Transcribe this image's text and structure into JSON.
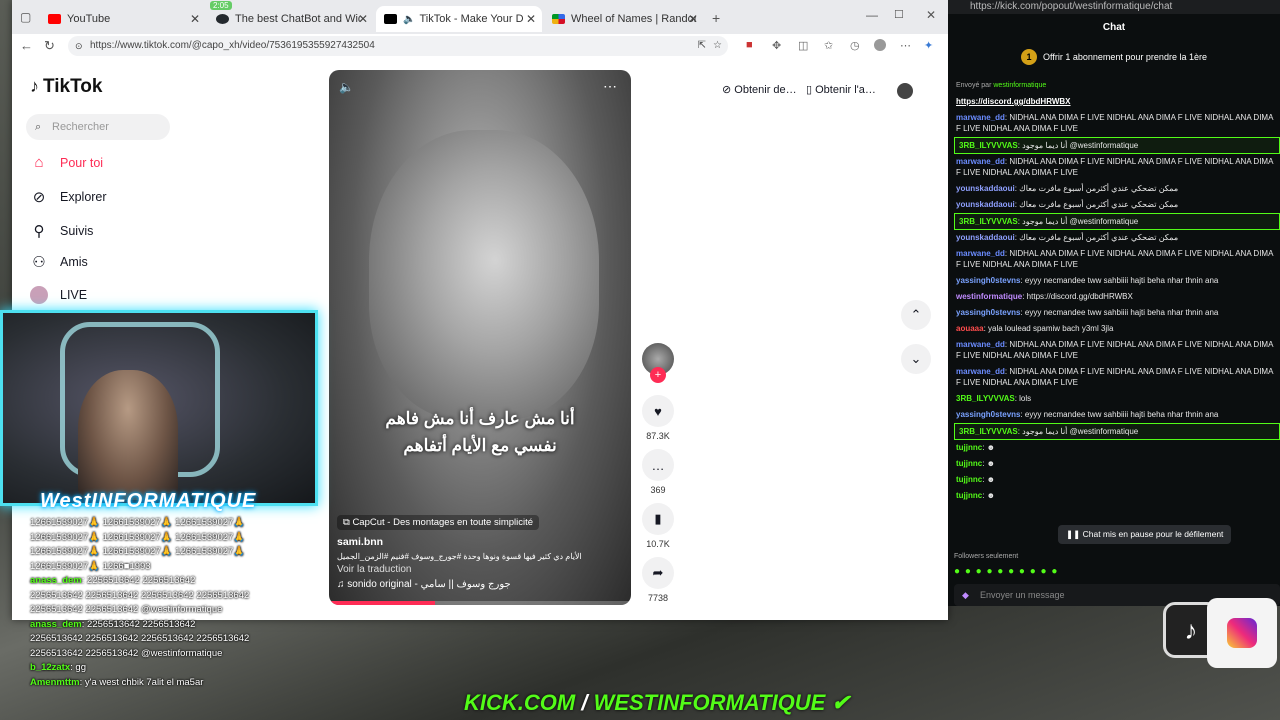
{
  "browser": {
    "tabs": [
      {
        "label": "YouTube",
        "favicon_color": "#ff0000"
      },
      {
        "label": "The best ChatBot and Widgets fo",
        "favicon_color": "#24292e"
      },
      {
        "label": "TikTok - Make Your Day",
        "favicon_color": "#000000",
        "active": true
      },
      {
        "label": "Wheel of Names | Random name",
        "favicon_color": "#3369e8"
      }
    ],
    "tab_badge": "2:05",
    "url": "https://www.tiktok.com/@capo_xh/video/7536195355927432504"
  },
  "tiktok": {
    "logo_text": "TikTok",
    "search_placeholder": "Rechercher",
    "nav": [
      {
        "label": "Pour toi",
        "icon": "home-icon",
        "active": true
      },
      {
        "label": "Explorer",
        "icon": "compass-icon"
      },
      {
        "label": "Suivis",
        "icon": "following-icon"
      },
      {
        "label": "Amis",
        "icon": "friends-icon"
      },
      {
        "label": "LIVE",
        "icon": "live-avatar-icon"
      }
    ],
    "header_buttons": {
      "get_coins": "Obtenir de…",
      "get_app": "Obtenir l'a…"
    },
    "video": {
      "caption_line1": "أنا مش عارف أنا مش فاهم",
      "caption_line2": "نفسي مع الأيام أتفاهم",
      "capcut": "CapCut - Des montages en toute simplicité",
      "author": "sami.bnn",
      "description": "الأيام دي كثير فيها قسوة ونوها وحدة #جورج_وسوف #فنيم #الزمن_الجميل",
      "translate": "Voir la traduction",
      "sound": "sonido original - جورج وسوف || سامي",
      "progress": 0.35
    },
    "actions": {
      "likes": "87.3K",
      "comments": "369",
      "saves": "10.7K",
      "shares": "7738"
    }
  },
  "overlay": {
    "banner": "WestINFORMATIQUE",
    "chat_lines": [
      {
        "user": "",
        "text": "12661539027🙏 12661539027🙏 12661539027🙏"
      },
      {
        "user": "",
        "text": "12661539027🙏 12661539027🙏 12661539027🙏"
      },
      {
        "user": "",
        "text": "12661539027🙏 12661539027🙏 12661539027🙏"
      },
      {
        "user": "",
        "text": "12661539027🙏 1266■1993"
      },
      {
        "user": "anass_dem",
        "text": ": 2256513642 2256513642"
      },
      {
        "user": "",
        "text": "2256513642 2256513642 2256513642 2256513642"
      },
      {
        "user": "",
        "text": "2256513642 2256513642 @westinformatique"
      },
      {
        "user": "anass_dem",
        "text": ": 2256513642 2256513642"
      },
      {
        "user": "",
        "text": "2256513642 2256513642 2256513642 2256513642"
      },
      {
        "user": "",
        "text": "2256513642 2256513642 @westinformatique"
      },
      {
        "user": "b_12zatx",
        "text": ": gg"
      },
      {
        "user": "Amenmttm",
        "text": ": y'a west chbik 7alit el ma5ar"
      }
    ],
    "kick_banner_left": "KICK.COM",
    "kick_banner_right": "WESTINFORMATIQUE"
  },
  "kick": {
    "url": "https://kick.com/popout/westinformatique/chat",
    "title": "Chat",
    "sub_offer": "Offrir 1 abonnement pour prendre la 1ère",
    "sent_by": "Envoyé par",
    "sent_by_user": "westinformatique",
    "pinned_link": "https://discord.gg/dbdHRWBX",
    "messages": [
      {
        "user": "marwane_dd",
        "color": "#6b8cff",
        "text": ": NIDHAL ANA DIMA F LIVE NIDHAL ANA DIMA F LIVE NIDHAL ANA DIMA F LIVE NIDHAL ANA DIMA F LIVE"
      },
      {
        "user": "3RB_ILYVVVAS",
        "color": "#53fc18",
        "text": ": أنا ديما موجود @westinformatique",
        "hl": true
      },
      {
        "user": "marwane_dd",
        "color": "#6b8cff",
        "text": ": NIDHAL ANA DIMA F LIVE NIDHAL ANA DIMA F LIVE NIDHAL ANA DIMA F LIVE NIDHAL ANA DIMA F LIVE"
      },
      {
        "user": "younskaddaoui",
        "color": "#8fa0ff",
        "text": ": ممكن تضحكي عندي أكثرمن أسبوع مافرت معاك"
      },
      {
        "user": "younskaddaoui",
        "color": "#8fa0ff",
        "text": ": ممكن تضحكي عندي أكثرمن أسبوع مافرت معاك"
      },
      {
        "user": "3RB_ILYVVVAS",
        "color": "#53fc18",
        "text": ": أنا ديما موجود @westinformatique",
        "hl": true
      },
      {
        "user": "younskaddaoui",
        "color": "#8fa0ff",
        "text": ": ممكن تضحكي عندي أكثرمن أسبوع مافرت معاك"
      },
      {
        "user": "marwane_dd",
        "color": "#6b8cff",
        "text": ": NIDHAL ANA DIMA F LIVE NIDHAL ANA DIMA F LIVE NIDHAL ANA DIMA F LIVE NIDHAL ANA DIMA F LIVE"
      },
      {
        "user": "yassingh0stevns",
        "color": "#7aa2ff",
        "text": ": eyyy necmandee tww sahbiiii hajti beha nhar thnin ana"
      },
      {
        "user": "westinformatique",
        "color": "#c08bff",
        "text": ": https://discord.gg/dbdHRWBX"
      },
      {
        "user": "yassingh0stevns",
        "color": "#7aa2ff",
        "text": ": eyyy necmandee tww sahbiiii hajti beha nhar thnin ana"
      },
      {
        "user": "aouaaa",
        "color": "#ff4d4d",
        "text": ": yala loulead spamiw bach y3ml 3jla"
      },
      {
        "user": "marwane_dd",
        "color": "#6b8cff",
        "text": ": NIDHAL ANA DIMA F LIVE NIDHAL ANA DIMA F LIVE NIDHAL ANA DIMA F LIVE NIDHAL ANA DIMA F LIVE"
      },
      {
        "user": "marwane_dd",
        "color": "#6b8cff",
        "text": ": NIDHAL ANA DIMA F LIVE NIDHAL ANA DIMA F LIVE NIDHAL ANA DIMA F LIVE NIDHAL ANA DIMA F LIVE"
      },
      {
        "user": "3RB_ILYVVVAS",
        "color": "#53fc18",
        "text": ": lols"
      },
      {
        "user": "yassingh0stevns",
        "color": "#7aa2ff",
        "text": ": eyyy necmandee tww sahbiiii hajti beha nhar thnin ana"
      },
      {
        "user": "3RB_ILYVVVAS",
        "color": "#53fc18",
        "text": ": أنا ديما موجود @westinformatique",
        "hl": true
      },
      {
        "user": "tujjnnc",
        "color": "#53fc18",
        "text": ": ☻"
      },
      {
        "user": "tujjnnc",
        "color": "#53fc18",
        "text": ": ☻"
      },
      {
        "user": "tujjnnc",
        "color": "#53fc18",
        "text": ": ☻"
      },
      {
        "user": "tujjnnc",
        "color": "#53fc18",
        "text": ": ☻"
      }
    ],
    "pause_label": "Chat mis en pause pour le défilement",
    "followers_only": "Followers seulement",
    "send_placeholder": "Envoyer un message"
  }
}
